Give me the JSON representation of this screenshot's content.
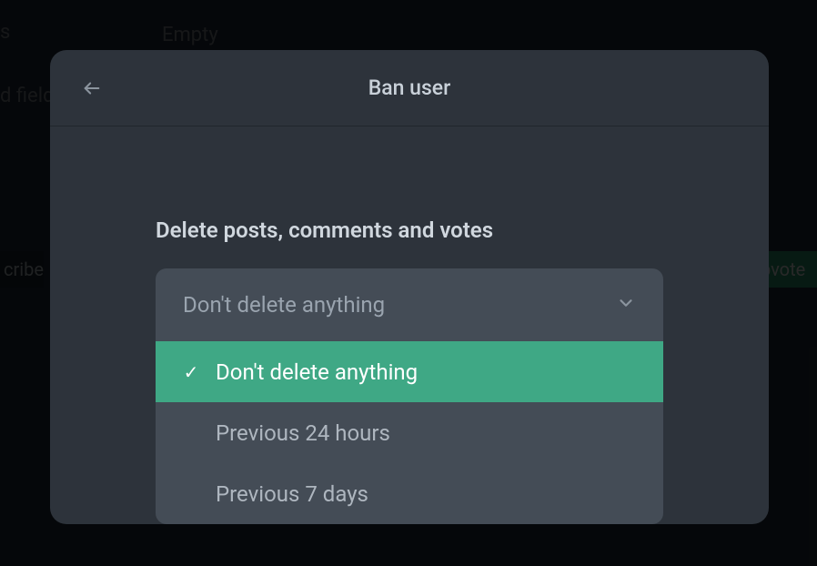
{
  "background": {
    "empty": "Empty",
    "field": "d field",
    "left_s": "s",
    "subscribe_partial": "cribe",
    "upvote_partial": "pvote"
  },
  "modal": {
    "title": "Ban user",
    "section_label": "Delete posts, comments and votes",
    "select": {
      "value": "Don't delete anything",
      "options": [
        {
          "label": "Don't delete anything",
          "selected": true
        },
        {
          "label": "Previous 24 hours",
          "selected": false
        },
        {
          "label": "Previous 7 days",
          "selected": false
        }
      ]
    }
  }
}
